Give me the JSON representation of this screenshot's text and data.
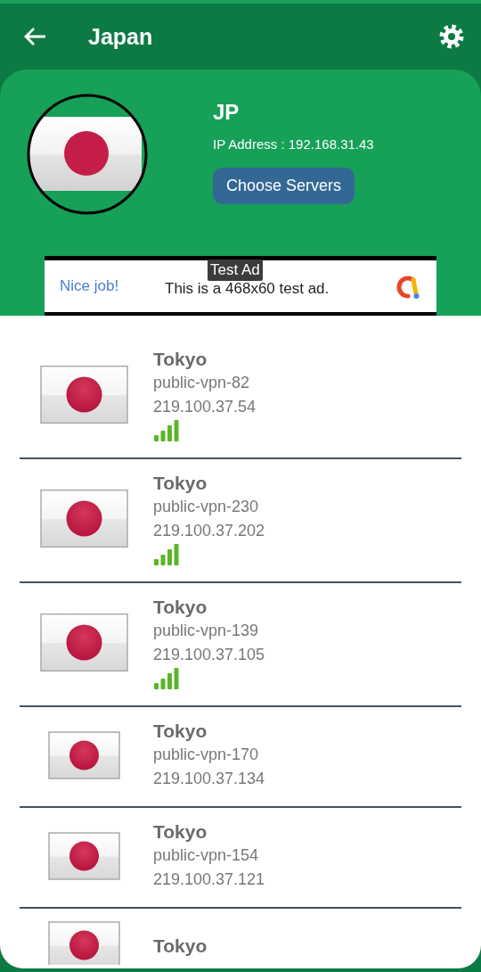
{
  "header": {
    "title": "Japan"
  },
  "country": {
    "code": "JP",
    "ip": "IP Address : 192.168.31.43",
    "button": "Choose Servers"
  },
  "ad": {
    "badge": "Test Ad",
    "headline": "Nice job!",
    "text": "This is a 468x60 test ad."
  },
  "servers": [
    {
      "kind": "signal",
      "city": "Tokyo",
      "host": "public-vpn-82",
      "ip": "219.100.37.54"
    },
    {
      "kind": "signal",
      "city": "Tokyo",
      "host": "public-vpn-230",
      "ip": "219.100.37.202"
    },
    {
      "kind": "signal",
      "city": "Tokyo",
      "host": "public-vpn-139",
      "ip": "219.100.37.105"
    },
    {
      "kind": "plain",
      "city": "Tokyo",
      "host": "public-vpn-170",
      "ip": "219.100.37.134"
    },
    {
      "kind": "plain",
      "city": "Tokyo",
      "host": "public-vpn-154",
      "ip": "219.100.37.121"
    },
    {
      "kind": "plain",
      "city": "Tokyo"
    }
  ]
}
